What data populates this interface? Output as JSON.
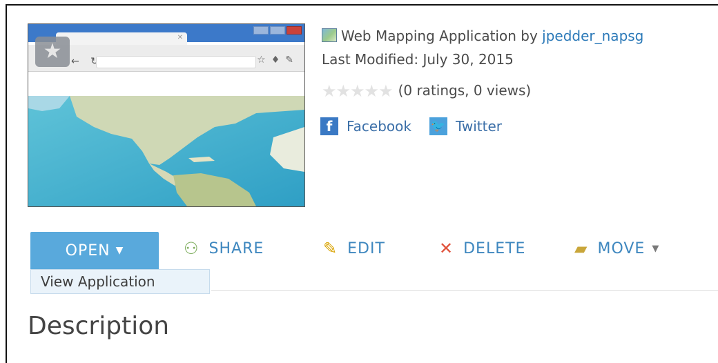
{
  "item": {
    "type_label": "Web Mapping Application by ",
    "owner": "jpedder_napsg",
    "last_modified": "Last Modified: July 30, 2015",
    "stars": "★★★★★",
    "ratings_text": "(0 ratings, 0 views)",
    "rating_value": 0
  },
  "social": {
    "facebook_label": "Facebook",
    "twitter_label": "Twitter"
  },
  "actions": {
    "open": "OPEN",
    "share": "SHARE",
    "edit": "EDIT",
    "delete": "DELETE",
    "move": "MOVE"
  },
  "open_menu": {
    "items": [
      "View Application"
    ]
  },
  "section": {
    "description_heading": "Description"
  },
  "icons": {
    "app": "web-mapping-app-icon",
    "facebook": "facebook-icon",
    "twitter": "twitter-icon",
    "share": "share-icon",
    "edit": "pencil-icon",
    "delete": "x-icon",
    "move": "folder-move-icon",
    "dropdown": "caret-down-icon"
  },
  "colors": {
    "accent": "#59a9dc",
    "link": "#2b79b8",
    "action_text": "#3e87bf",
    "delete_icon": "#e0513a",
    "dropdown_bg": "#eaf3fa"
  }
}
